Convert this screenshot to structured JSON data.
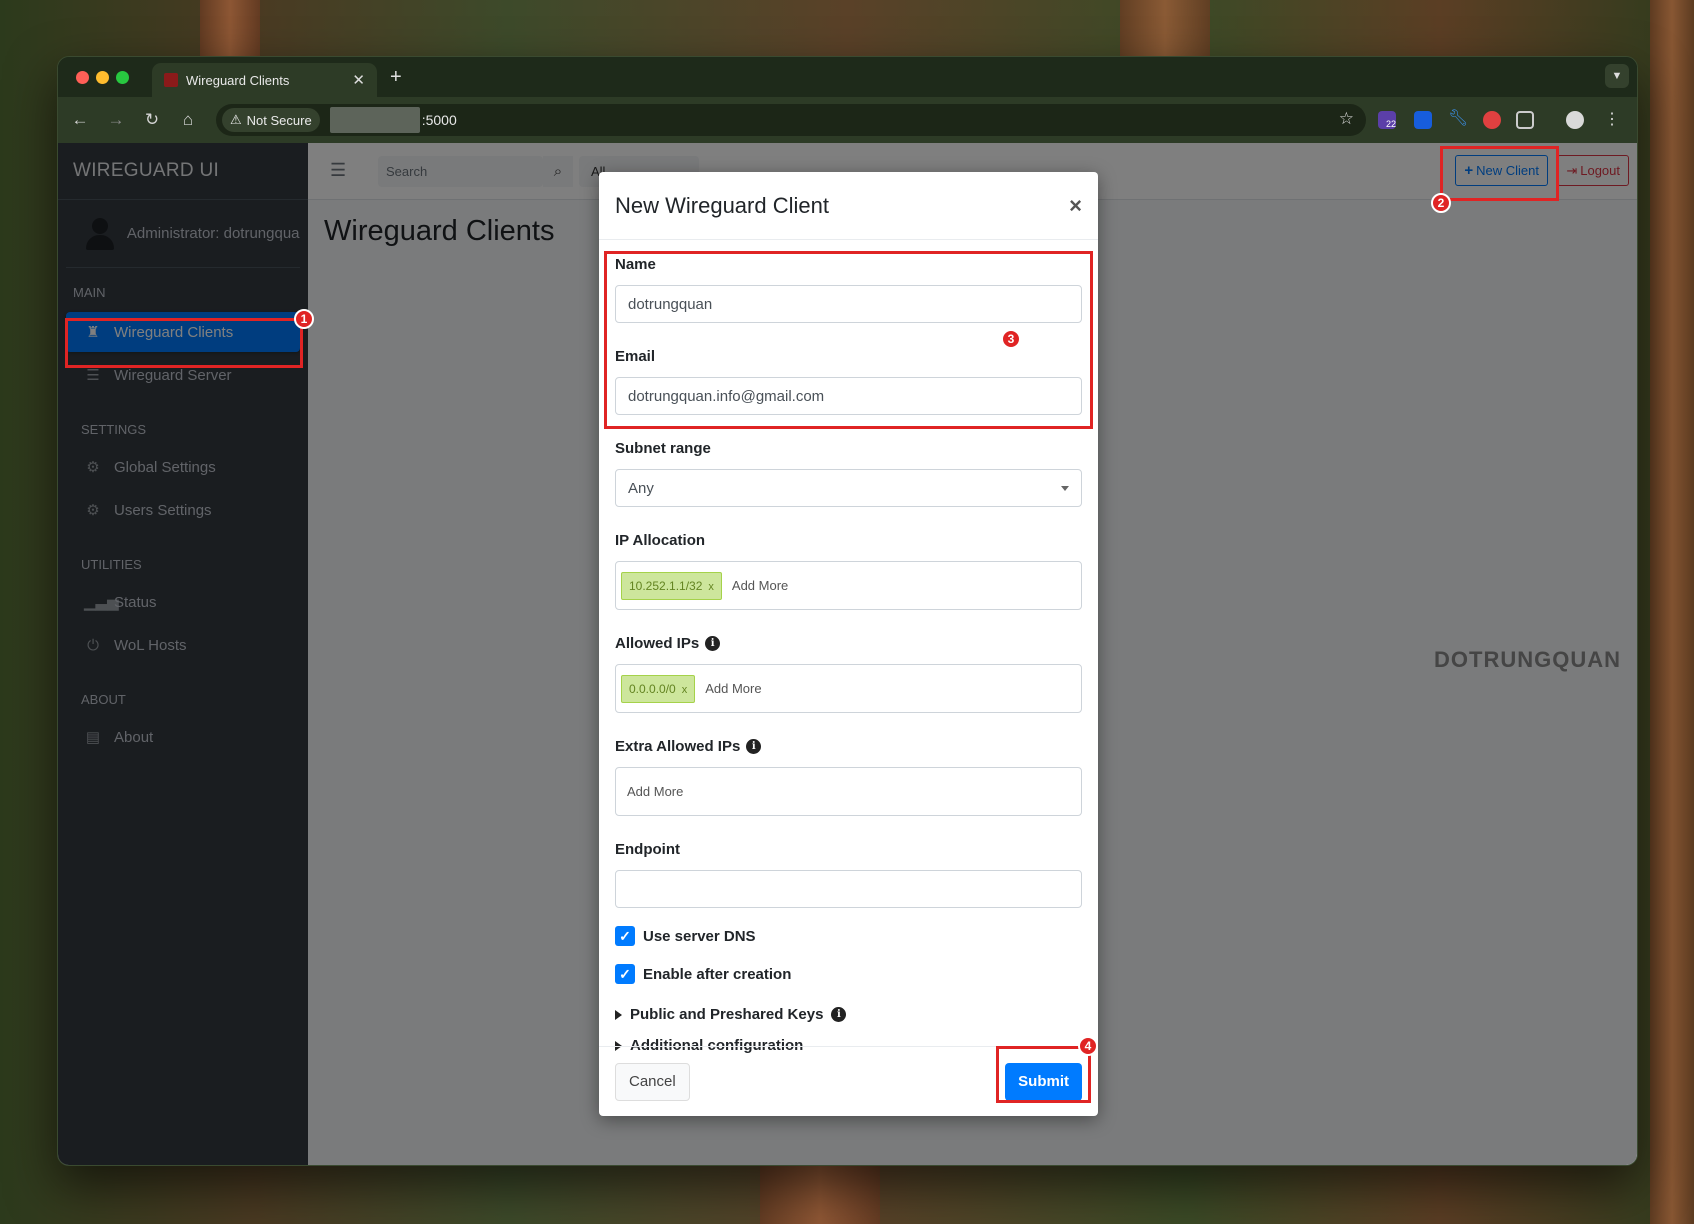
{
  "browser": {
    "tab_title": "Wireguard Clients",
    "new_tab": "+",
    "security_label": "Not Secure",
    "url_suffix": ":5000",
    "ext_badge": "22"
  },
  "sidebar": {
    "brand": "WIREGUARD UI",
    "user": "Administrator: dotrungquan",
    "sections": [
      {
        "header": "MAIN",
        "items": [
          {
            "label": "Wireguard Clients",
            "icon": "user-secret-icon"
          },
          {
            "label": "Wireguard Server",
            "icon": "server-icon"
          }
        ]
      },
      {
        "header": "SETTINGS",
        "items": [
          {
            "label": "Global Settings",
            "icon": "gear-icon"
          },
          {
            "label": "Users Settings",
            "icon": "gear-icon"
          }
        ]
      },
      {
        "header": "UTILITIES",
        "items": [
          {
            "label": "Status",
            "icon": "signal-icon"
          },
          {
            "label": "WoL Hosts",
            "icon": "power-icon"
          }
        ]
      },
      {
        "header": "ABOUT",
        "items": [
          {
            "label": "About",
            "icon": "id-card-icon"
          }
        ]
      }
    ]
  },
  "topnav": {
    "search_placeholder": "Search",
    "filter_value": "All",
    "new_client": "New Client",
    "logout": "Logout"
  },
  "main": {
    "title": "Wireguard Clients",
    "watermark": "DOTRUNGQUAN"
  },
  "modal": {
    "title": "New Wireguard Client",
    "close": "×",
    "name_label": "Name",
    "name_value": "dotrungquan",
    "email_label": "Email",
    "email_value": "dotrungquan.info@gmail.com",
    "subnet_label": "Subnet range",
    "subnet_value": "Any",
    "ip_alloc_label": "IP Allocation",
    "ip_alloc_tag": "10.252.1.1/32",
    "allowed_label": "Allowed IPs",
    "allowed_tag": "0.0.0.0/0",
    "extra_label": "Extra Allowed IPs",
    "add_more": "Add More",
    "endpoint_label": "Endpoint",
    "endpoint_value": "",
    "use_dns": "Use server DNS",
    "enable_after": "Enable after creation",
    "keys_label": "Public and Preshared Keys",
    "additional_label": "Additional configuration",
    "cancel": "Cancel",
    "submit": "Submit"
  },
  "annotations": [
    "1",
    "2",
    "3",
    "4"
  ],
  "colors": {
    "accent": "#007bff",
    "highlight": "#e02424",
    "danger": "#dc3545",
    "sidebar": "#343a40"
  }
}
